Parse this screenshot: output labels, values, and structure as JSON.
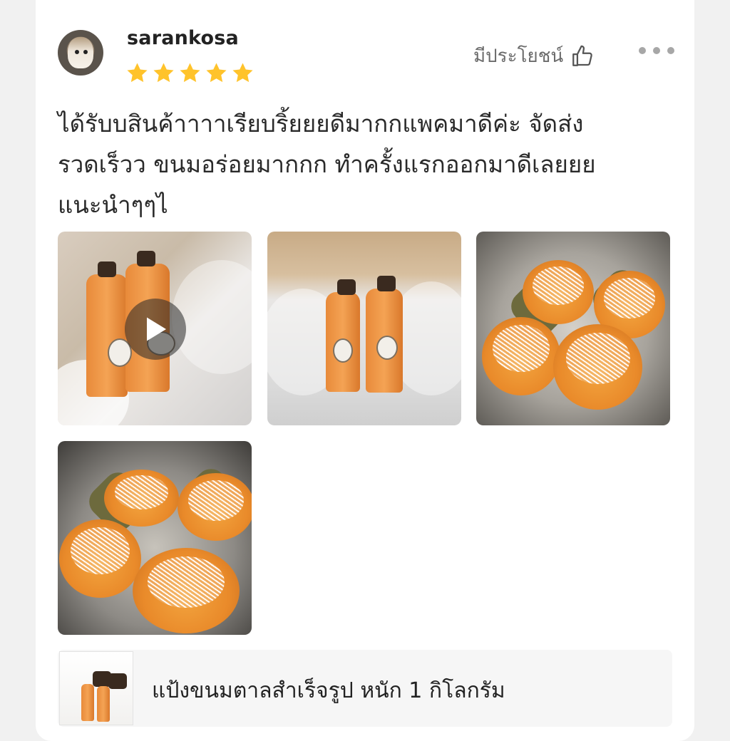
{
  "review": {
    "username": "sarankosa",
    "rating": 5,
    "rating_max": 5,
    "helpful_label": "มีประโยชน์",
    "text": "ได้รับบสินค้าาาาเรียบริ้ยยยดีมากกแพคมาดีค่ะ จัดส่งรวดเร็วว ขนมอร่อยมากกก ทำครั้งแรกออกมาดีเลยยยแนะนำๆๆไ",
    "text_lines": [
      "ได้รับบสินค้าาาาเรียบริ้ยยยดีมากกแพคมาดีค่ะ จัดส่ง",
      "รวดเร็วว ขนมอร่อยมากกก ทำครั้งแรกออกมาดีเลยยย",
      "แนะนำๆๆไ"
    ],
    "media": [
      {
        "type": "video",
        "subject": "two orange bottles in box"
      },
      {
        "type": "photo",
        "subject": "bottles packed in box"
      },
      {
        "type": "photo",
        "subject": "coconut-topped cakes on tray"
      },
      {
        "type": "photo",
        "subject": "coconut-topped cakes on tray"
      }
    ]
  },
  "product": {
    "name": "แป้งขนมตาลสำเร็จรูป หนัก 1 กิโลกรัม"
  },
  "colors": {
    "star": "#ffc32b",
    "text": "#2a2a2a",
    "muted": "#6b6b6b",
    "background": "#f1f1f1",
    "card": "#ffffff"
  },
  "icons": [
    "avatar",
    "star-icon",
    "thumbs-up-icon",
    "more-icon",
    "play-icon"
  ]
}
